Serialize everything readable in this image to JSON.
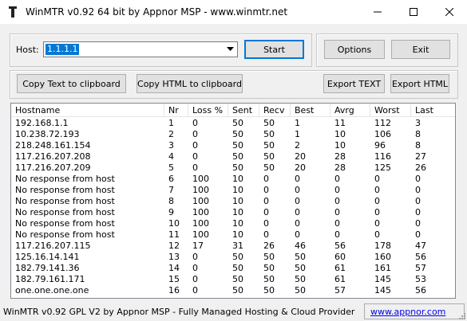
{
  "window": {
    "title": "WinMTR v0.92 64 bit by Appnor MSP - www.winmtr.net",
    "icons": {
      "app": "winmtr-app-icon",
      "minimize": "minimize-icon",
      "maximize": "maximize-icon",
      "close": "close-icon"
    }
  },
  "host": {
    "label": "Host:",
    "value": "1.1.1.1",
    "dropdown_icon": "chevron-down-icon"
  },
  "buttons": {
    "start": "Start",
    "options": "Options",
    "exit": "Exit",
    "copy_text": "Copy Text to clipboard",
    "copy_html": "Copy HTML to clipboard",
    "export_text": "Export TEXT",
    "export_html": "Export HTML"
  },
  "table": {
    "headers": [
      "Hostname",
      "Nr",
      "Loss %",
      "Sent",
      "Recv",
      "Best",
      "Avrg",
      "Worst",
      "Last"
    ],
    "rows": [
      [
        "192.168.1.1",
        "1",
        "0",
        "50",
        "50",
        "1",
        "11",
        "112",
        "3"
      ],
      [
        "10.238.72.193",
        "2",
        "0",
        "50",
        "50",
        "1",
        "10",
        "106",
        "8"
      ],
      [
        "218.248.161.154",
        "3",
        "0",
        "50",
        "50",
        "2",
        "10",
        "96",
        "8"
      ],
      [
        "117.216.207.208",
        "4",
        "0",
        "50",
        "50",
        "20",
        "28",
        "116",
        "27"
      ],
      [
        "117.216.207.209",
        "5",
        "0",
        "50",
        "50",
        "20",
        "28",
        "125",
        "26"
      ],
      [
        "No response from host",
        "6",
        "100",
        "10",
        "0",
        "0",
        "0",
        "0",
        "0"
      ],
      [
        "No response from host",
        "7",
        "100",
        "10",
        "0",
        "0",
        "0",
        "0",
        "0"
      ],
      [
        "No response from host",
        "8",
        "100",
        "10",
        "0",
        "0",
        "0",
        "0",
        "0"
      ],
      [
        "No response from host",
        "9",
        "100",
        "10",
        "0",
        "0",
        "0",
        "0",
        "0"
      ],
      [
        "No response from host",
        "10",
        "100",
        "10",
        "0",
        "0",
        "0",
        "0",
        "0"
      ],
      [
        "No response from host",
        "11",
        "100",
        "10",
        "0",
        "0",
        "0",
        "0",
        "0"
      ],
      [
        "117.216.207.115",
        "12",
        "17",
        "31",
        "26",
        "46",
        "56",
        "178",
        "47"
      ],
      [
        "125.16.14.141",
        "13",
        "0",
        "50",
        "50",
        "50",
        "60",
        "160",
        "56"
      ],
      [
        "182.79.141.36",
        "14",
        "0",
        "50",
        "50",
        "50",
        "61",
        "161",
        "57"
      ],
      [
        "182.79.161.171",
        "15",
        "0",
        "50",
        "50",
        "50",
        "61",
        "145",
        "53"
      ],
      [
        "one.one.one.one",
        "16",
        "0",
        "50",
        "50",
        "50",
        "57",
        "145",
        "56"
      ]
    ]
  },
  "status": {
    "text": "WinMTR v0.92 GPL V2 by Appnor MSP - Fully Managed Hosting & Cloud Provider",
    "link": "www.appnor.com",
    "grip_icon": "size-grip-icon"
  }
}
